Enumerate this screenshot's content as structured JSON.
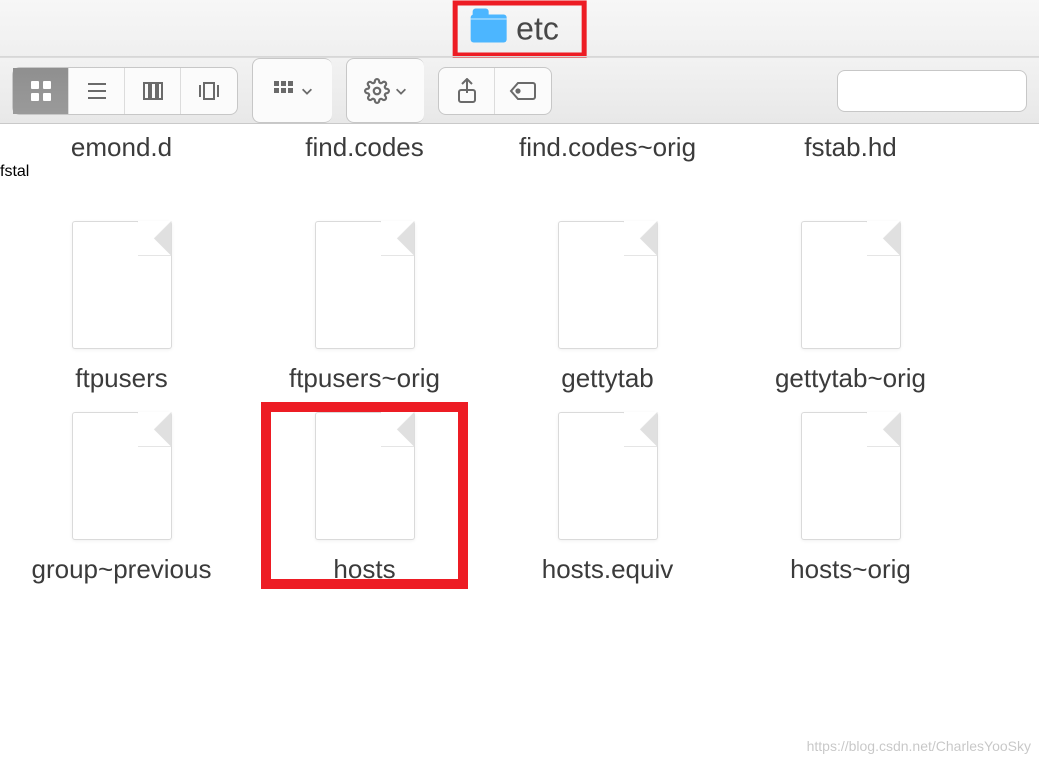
{
  "window": {
    "folder_name": "etc"
  },
  "toolbar": {
    "view_modes": [
      "icon",
      "list",
      "column",
      "coverflow"
    ],
    "active_view": "icon",
    "arrange_label": "arrange",
    "action_label": "action",
    "share_label": "share",
    "tags_label": "tags"
  },
  "files": {
    "row_top": [
      "emond.d",
      "find.codes",
      "find.codes~orig",
      "fstab.hd",
      "fstal"
    ],
    "row1": [
      "ftpusers",
      "ftpusers~orig",
      "gettytab",
      "gettytab~orig"
    ],
    "row2": [
      "group~previous",
      "hosts",
      "hosts.equiv",
      "hosts~orig"
    ]
  },
  "highlights": {
    "title_box": true,
    "hosts_box": true
  },
  "watermark": "https://blog.csdn.net/CharlesYooSky"
}
